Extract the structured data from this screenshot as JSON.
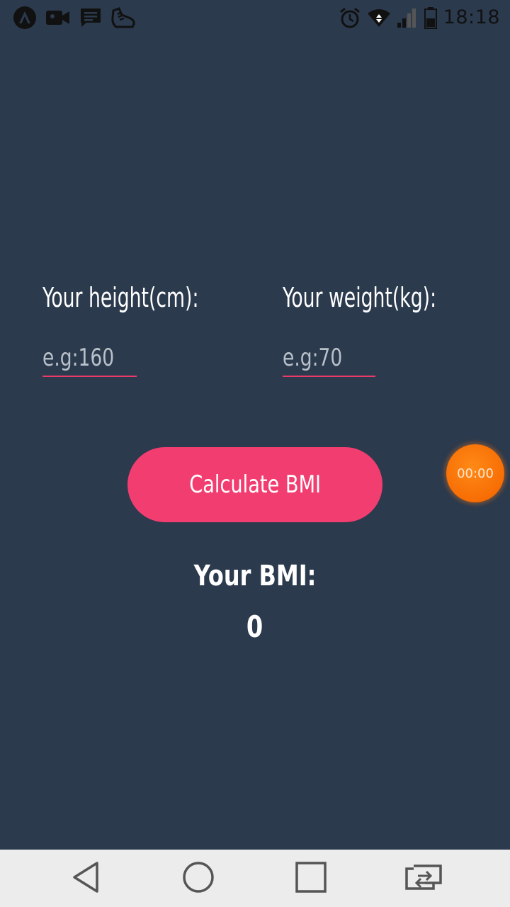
{
  "status_bar": {
    "time": "18:18",
    "left_icons": [
      "app-a-icon",
      "video-camera-icon",
      "message-icon",
      "shoe-icon"
    ],
    "right_icons": [
      "alarm-icon",
      "wifi-icon",
      "signal-icon",
      "battery-icon"
    ]
  },
  "form": {
    "height_label": "Your height(cm):",
    "height_placeholder": "e.g:160",
    "height_value": "",
    "weight_label": "Your weight(kg):",
    "weight_placeholder": "e.g:70",
    "weight_value": ""
  },
  "button": {
    "label": "Calculate BMI"
  },
  "result": {
    "title": "Your BMI:",
    "value": "0"
  },
  "timer": {
    "label": "00:00"
  },
  "nav_bar": {
    "buttons": [
      "back-icon",
      "home-icon",
      "recent-apps-icon",
      "switch-app-icon"
    ]
  },
  "colors": {
    "background": "#2b3a4d",
    "accent": "#f23d70",
    "timer": "#f76d04",
    "nav_bar": "#ececec"
  }
}
